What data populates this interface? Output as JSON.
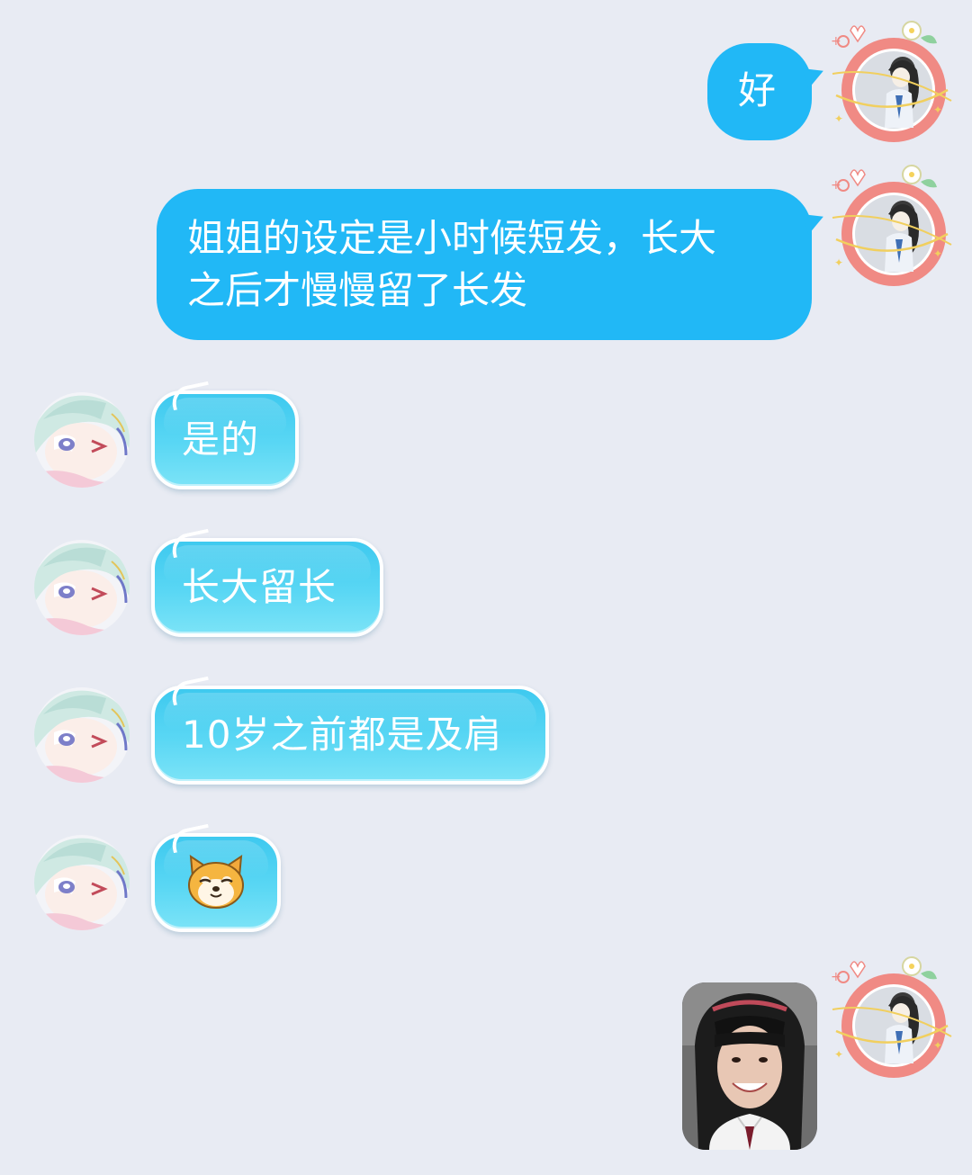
{
  "chat": {
    "messages": [
      {
        "side": "out",
        "text": "好"
      },
      {
        "side": "out",
        "text_line1": "姐姐的设定是小时候短发，长大",
        "text_line2": "之后才慢慢留了长发"
      },
      {
        "side": "in",
        "text": "是的"
      },
      {
        "side": "in",
        "text": "长大留长"
      },
      {
        "side": "in",
        "text": "10岁之前都是及肩"
      },
      {
        "side": "in",
        "sticker": "shiba-dog-emoji"
      },
      {
        "side": "out",
        "image": "photo-smiling-girl"
      }
    ]
  },
  "colors": {
    "background": "#e8ebf3",
    "outgoing_bubble": "#21b8f6",
    "incoming_bubble": "#4fd2f2",
    "avatar_frame": "#f0837f"
  },
  "icons": {
    "sender_avatar": "girl-avatar-strawberry-frame",
    "receiver_avatar": "anime-boy-avatar",
    "sticker": "shiba-dog-icon"
  }
}
